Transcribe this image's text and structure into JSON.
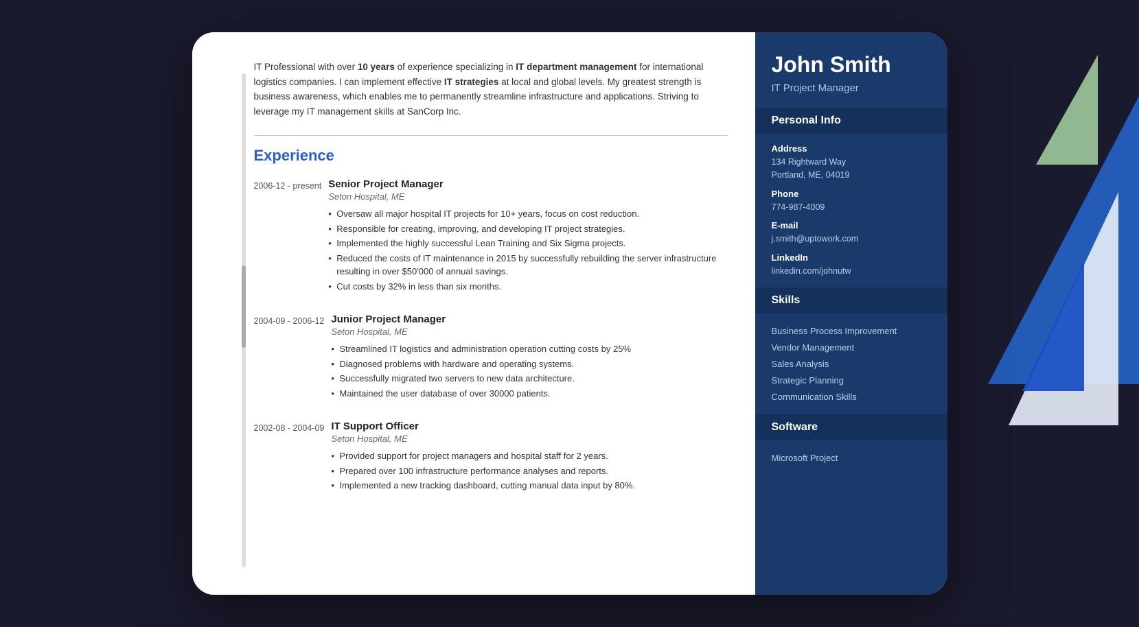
{
  "resume": {
    "right": {
      "name": "John Smith",
      "title": "IT Project Manager",
      "sections": {
        "personal_info": {
          "label": "Personal Info",
          "fields": {
            "address": {
              "label": "Address",
              "lines": [
                "134 Rightward Way",
                "Portland, ME, 04019"
              ]
            },
            "phone": {
              "label": "Phone",
              "value": "774-987-4009"
            },
            "email": {
              "label": "E-mail",
              "value": "j.smith@uptowork.com"
            },
            "linkedin": {
              "label": "LinkedIn",
              "value": "linkedin.com/johnutw"
            }
          }
        },
        "skills": {
          "label": "Skills",
          "items": [
            "Business Process Improvement",
            "Vendor Management",
            "Sales Analysis",
            "Strategic Planning",
            "Communication Skills"
          ]
        },
        "software": {
          "label": "Software",
          "items": [
            "Microsoft Project"
          ]
        }
      }
    },
    "left": {
      "summary": {
        "text_parts": [
          "IT Professional with over ",
          "10 years",
          " of experience specializing in ",
          "IT department management",
          " for international logistics companies. I can implement effective ",
          "IT strategies",
          " at local and global levels. My greatest strength is business awareness, which enables me to permanently streamline infrastructure and applications. Striving to leverage my IT management skills at SanCorp Inc."
        ]
      },
      "experience_section_label": "Experience",
      "experience": [
        {
          "dates": "2006-12 - present",
          "title": "Senior Project Manager",
          "company": "Seton Hospital, ME",
          "bullets": [
            "Oversaw all major hospital IT projects for 10+ years, focus on cost reduction.",
            "Responsible for creating, improving, and developing IT project strategies.",
            "Implemented the highly successful Lean Training and Six Sigma projects.",
            "Reduced the costs of IT maintenance in 2015 by successfully rebuilding the server infrastructure resulting in over $50'000 of annual savings.",
            "Cut costs by 32% in less than six months."
          ]
        },
        {
          "dates": "2004-09 - 2006-12",
          "title": "Junior Project Manager",
          "company": "Seton Hospital, ME",
          "bullets": [
            "Streamlined IT logistics and administration operation cutting costs by 25%",
            "Diagnosed problems with hardware and operating systems.",
            "Successfully migrated two servers to new data architecture.",
            "Maintained the user database of over 30000 patients."
          ]
        },
        {
          "dates": "2002-08 - 2004-09",
          "title": "IT Support Officer",
          "company": "Seton Hospital, ME",
          "bullets": [
            "Provided support for project managers and hospital staff for 2 years.",
            "Prepared over 100 infrastructure performance analyses and reports.",
            "Implemented a new tracking dashboard, cutting manual data input by 80%."
          ]
        }
      ]
    }
  }
}
